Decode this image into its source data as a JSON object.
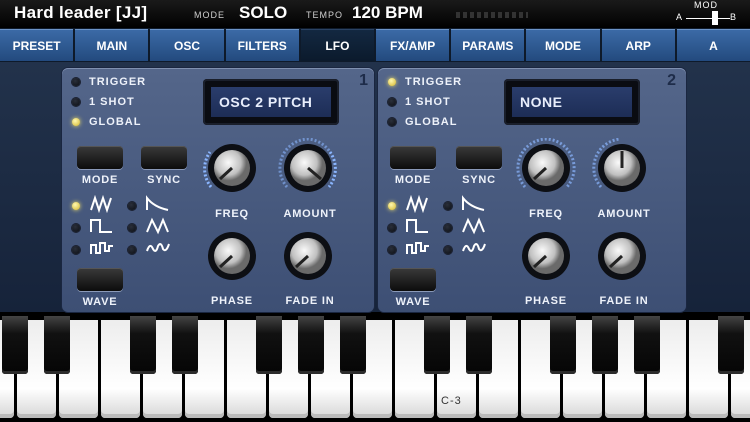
{
  "topbar": {
    "preset_name": "Hard leader [JJ]",
    "mode_label": "MODE",
    "mode_value": "SOLO",
    "tempo_label": "TEMPO",
    "tempo_value": "120 BPM",
    "mod_label": "MOD",
    "mod_a": "A",
    "mod_b": "B"
  },
  "tabs": [
    {
      "label": "PRESET",
      "active": false
    },
    {
      "label": "MAIN",
      "active": false
    },
    {
      "label": "OSC",
      "active": false
    },
    {
      "label": "FILTERS",
      "active": false
    },
    {
      "label": "LFO",
      "active": true
    },
    {
      "label": "FX/AMP",
      "active": false
    },
    {
      "label": "PARAMS",
      "active": false
    },
    {
      "label": "MODE",
      "active": false
    },
    {
      "label": "ARP",
      "active": false
    },
    {
      "label": "A",
      "active": false
    }
  ],
  "lfo1": {
    "number": "1",
    "options": [
      {
        "label": "TRIGGER",
        "on": false
      },
      {
        "label": "1 SHOT",
        "on": false
      },
      {
        "label": "GLOBAL",
        "on": true
      }
    ],
    "target": "OSC 2 PITCH",
    "mode_label": "MODE",
    "sync_label": "SYNC",
    "wave_label": "WAVE",
    "freq_label": "FREQ",
    "amount_label": "AMOUNT",
    "phase_label": "PHASE",
    "fadein_label": "FADE IN",
    "selected_wave": "sine"
  },
  "lfo2": {
    "number": "2",
    "options": [
      {
        "label": "TRIGGER",
        "on": true
      },
      {
        "label": "1 SHOT",
        "on": false
      },
      {
        "label": "GLOBAL",
        "on": false
      }
    ],
    "target": "NONE",
    "mode_label": "MODE",
    "sync_label": "SYNC",
    "wave_label": "WAVE",
    "freq_label": "FREQ",
    "amount_label": "AMOUNT",
    "phase_label": "PHASE",
    "fadein_label": "FADE IN",
    "selected_wave": "sine"
  },
  "keyboard": {
    "c3_label": "C-3"
  },
  "colors": {
    "tab_active": "#0b1a2c",
    "tab_inactive": "#2d5a93",
    "panel": "#4a5b80",
    "led_on": "#f5e36a"
  }
}
